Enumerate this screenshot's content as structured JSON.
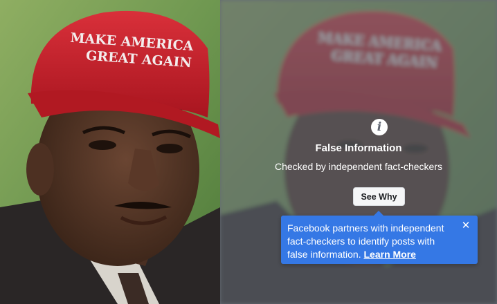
{
  "photo": {
    "hat_text_line1": "MAKE AMERICA",
    "hat_text_line2": "GREAT AGAIN"
  },
  "warning": {
    "icon": "info-icon",
    "icon_glyph": "i",
    "title": "False Information",
    "subtitle": "Checked by independent fact-checkers",
    "see_why_label": "See Why"
  },
  "tooltip": {
    "message": "Facebook partners with independent fact-checkers to identify posts with false information.",
    "learn_more_label": "Learn More",
    "close_icon": "close-icon",
    "close_glyph": "✕"
  },
  "colors": {
    "tooltip_bg": "#3578e5",
    "overlay": "#606570",
    "hat_red": "#c8202a"
  }
}
